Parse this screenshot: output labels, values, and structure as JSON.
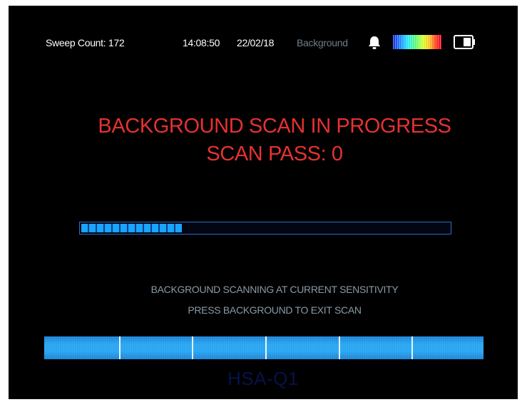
{
  "status_bar": {
    "sweep_count": "Sweep Count: 172",
    "time": "14:08:50",
    "date": "22/02/18",
    "mode": "Background",
    "bell_icon": "bell-icon",
    "palette_icon": "color-palette-icon",
    "battery_icon": "battery-icon"
  },
  "message": {
    "line1": "BACKGROUND SCAN IN PROGRESS",
    "line2": "SCAN PASS: 0"
  },
  "progress": {
    "fraction": 0.26
  },
  "info": {
    "line1": "BACKGROUND SCANNING AT CURRENT SENSITIVITY",
    "line2": "PRESS BACKGROUND TO EXIT SCAN"
  },
  "bottom_bar": {
    "segments": 6
  },
  "model": "HSA-Q1",
  "colors": {
    "background": "#000000",
    "headline": "#e5322f",
    "info_text": "#8a9aa6",
    "accent_blue": "#1aa3ff",
    "mode_text": "#6f7d86"
  }
}
